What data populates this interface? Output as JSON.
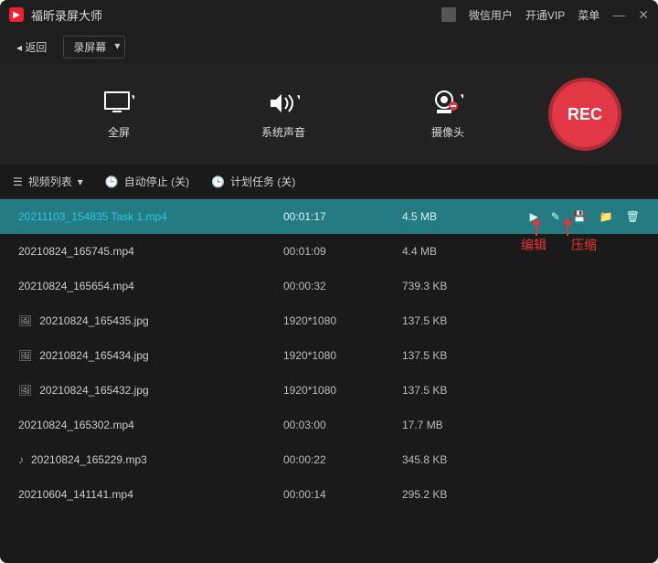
{
  "titlebar": {
    "app_name": "福昕录屏大师",
    "user_type": "微信用户",
    "vip_label": "开通VIP",
    "menu_label": "菜单"
  },
  "subbar": {
    "back_label": "◂ 返回",
    "mode_label": "录屏幕"
  },
  "options": {
    "fullscreen": "全屏",
    "sysaudio": "系统声音",
    "camera": "摄像头",
    "rec": "REC"
  },
  "tabbar": {
    "list_label": "视频列表",
    "autostop_label": "自动停止 (关)",
    "schedule_label": "计划任务 (关)"
  },
  "files": [
    {
      "name": "20211103_154835 Task 1.mp4",
      "dur": "00:01:17",
      "size": "4.5 MB",
      "type": "video",
      "active": true
    },
    {
      "name": "20210824_165745.mp4",
      "dur": "00:01:09",
      "size": "4.4 MB",
      "type": "video"
    },
    {
      "name": "20210824_165654.mp4",
      "dur": "00:00:32",
      "size": "739.3 KB",
      "type": "video"
    },
    {
      "name": "20210824_165435.jpg",
      "dur": "1920*1080",
      "size": "137.5 KB",
      "type": "image"
    },
    {
      "name": "20210824_165434.jpg",
      "dur": "1920*1080",
      "size": "137.5 KB",
      "type": "image"
    },
    {
      "name": "20210824_165432.jpg",
      "dur": "1920*1080",
      "size": "137.5 KB",
      "type": "image"
    },
    {
      "name": "20210824_165302.mp4",
      "dur": "00:03:00",
      "size": "17.7 MB",
      "type": "video"
    },
    {
      "name": "20210824_165229.mp3",
      "dur": "00:00:22",
      "size": "345.8 KB",
      "type": "audio"
    },
    {
      "name": "20210604_141141.mp4",
      "dur": "00:00:14",
      "size": "295.2 KB",
      "type": "video"
    }
  ],
  "annotations": {
    "edit": "编辑",
    "compress": "压缩"
  },
  "colors": {
    "accent": "#e23744",
    "selected_row": "#247c82",
    "annot": "#e33"
  }
}
